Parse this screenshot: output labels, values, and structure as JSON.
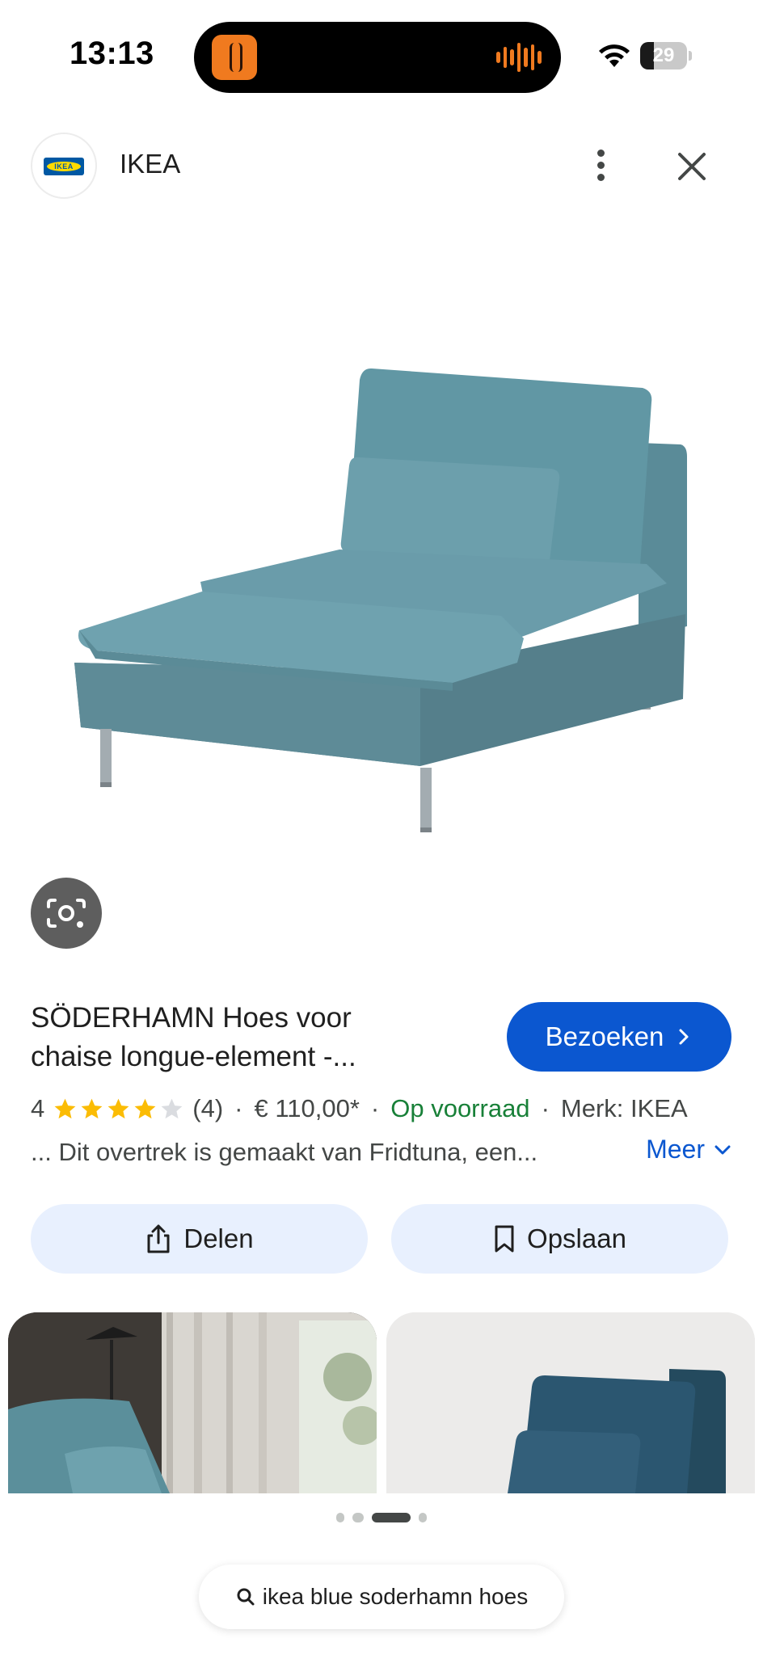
{
  "status_bar": {
    "time": "13:13",
    "battery": "29",
    "battery_level": 0.29
  },
  "header": {
    "logo_text": "IKEA",
    "site_name": "IKEA"
  },
  "product": {
    "title_line1": "SÖDERHAMN Hoes voor",
    "title_line2": "chaise longue-element -...",
    "visit_label": "Bezoeken",
    "rating_value": "4",
    "rating_stars": 4,
    "rating_count": "(4)",
    "separator": "·",
    "price": "€ 110,00*",
    "stock": "Op voorraad",
    "brand": "Merk: IKEA",
    "description": "... Dit overtrek is gemaakt van Fridtuna, een...",
    "more_label": "Meer"
  },
  "actions": {
    "share_label": "Delen",
    "save_label": "Opslaan"
  },
  "pager": {
    "count": 4,
    "active_index": 2
  },
  "search": {
    "query": "ikea blue soderhamn hoes"
  },
  "colors": {
    "accent": "#0b57d0",
    "stock": "#188038",
    "star": "#fbbc04",
    "button_bg": "#e8f0fe",
    "sofa": "#5f93a0"
  }
}
